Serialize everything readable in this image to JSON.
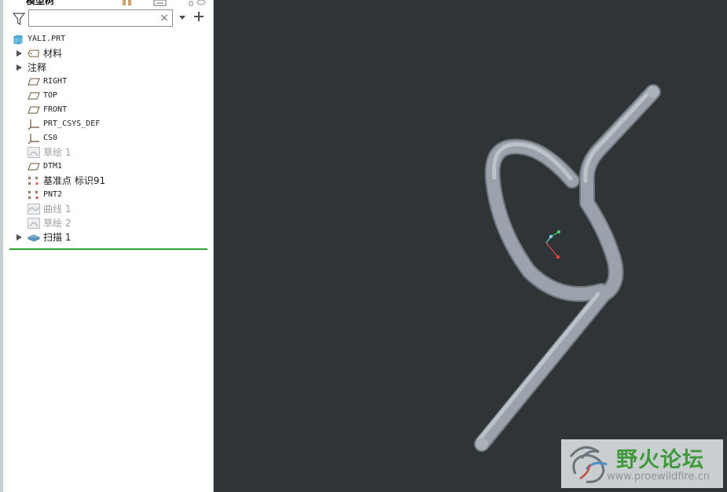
{
  "panel": {
    "title": "模型树",
    "search": {
      "value": "",
      "placeholder": ""
    },
    "clear_glyph": "×"
  },
  "tree": [
    {
      "label": "YALI.PRT",
      "icon": "part-icon",
      "expandable": false,
      "dim": false
    },
    {
      "label": "材料",
      "icon": "material-tag-icon",
      "expandable": true,
      "dim": false
    },
    {
      "label": "注释",
      "icon": "",
      "expandable": true,
      "dim": false
    },
    {
      "label": "RIGHT",
      "icon": "datum-plane-icon",
      "expandable": false,
      "dim": false
    },
    {
      "label": "TOP",
      "icon": "datum-plane-icon",
      "expandable": false,
      "dim": false
    },
    {
      "label": "FRONT",
      "icon": "datum-plane-icon",
      "expandable": false,
      "dim": false
    },
    {
      "label": "PRT_CSYS_DEF",
      "icon": "csys-icon",
      "expandable": false,
      "dim": false
    },
    {
      "label": "CS0",
      "icon": "csys-icon",
      "expandable": false,
      "dim": false
    },
    {
      "label": "草绘 1",
      "icon": "sketch-icon",
      "expandable": false,
      "dim": true
    },
    {
      "label": "DTM1",
      "icon": "datum-plane-icon",
      "expandable": false,
      "dim": false
    },
    {
      "label": "基准点 标识91",
      "icon": "datum-point-icon",
      "expandable": false,
      "dim": false
    },
    {
      "label": "PNT2",
      "icon": "datum-point-icon",
      "expandable": false,
      "dim": false
    },
    {
      "label": "曲线 1",
      "icon": "curve-icon",
      "expandable": false,
      "dim": true
    },
    {
      "label": "草绘 2",
      "icon": "sketch-icon",
      "expandable": false,
      "dim": true
    },
    {
      "label": "扫描 1",
      "icon": "sweep-icon",
      "expandable": true,
      "dim": false
    }
  ],
  "watermark": {
    "title": "野火论坛",
    "url": "www.proewildfire.cn"
  },
  "colors": {
    "viewport_bg": "#2f3436",
    "spring": "#9aa3ab",
    "insert_line": "#2ea52e",
    "watermark_green": "#3f9a3a"
  }
}
